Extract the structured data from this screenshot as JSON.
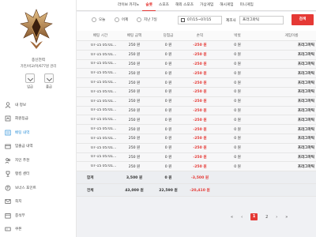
{
  "sidebar": {
    "profile_title": "종신전력",
    "profile_sub": "가민/비교/아/677원 관리",
    "quick": [
      {
        "label": "입금"
      },
      {
        "label": "출금"
      }
    ],
    "items": [
      {
        "label": "내 정보",
        "icon": "user-icon",
        "active": false
      },
      {
        "label": "회원등급",
        "icon": "grade-icon",
        "active": false
      },
      {
        "label": "배팅 내역",
        "icon": "list-icon",
        "active": true
      },
      {
        "label": "입출금 내역",
        "icon": "wallet-icon",
        "active": false
      },
      {
        "label": "지인 추천",
        "icon": "friends-icon",
        "active": false
      },
      {
        "label": "랭킹 센터",
        "icon": "trophy-icon",
        "active": false
      },
      {
        "label": "보너스 포인트",
        "icon": "coin-icon",
        "active": false
      },
      {
        "label": "쪽지",
        "icon": "message-icon",
        "active": false
      },
      {
        "label": "충석부",
        "icon": "calendar-icon",
        "active": false
      },
      {
        "label": "쿠폰",
        "icon": "coupon-icon",
        "active": false
      }
    ]
  },
  "tabs": [
    {
      "label": "라이브 카지노",
      "active": false
    },
    {
      "label": "슬롯",
      "active": true
    },
    {
      "label": "스포츠",
      "active": false
    },
    {
      "label": "해외 스포츠",
      "active": false
    },
    {
      "label": "가상게임",
      "active": false
    },
    {
      "label": "해시게임",
      "active": false
    },
    {
      "label": "미니게임",
      "active": false
    }
  ],
  "filter": {
    "today": "오늘",
    "yesterday": "어제",
    "last7": "지난 7일",
    "date_range": "07/15~07/15",
    "maker_label": "제조사",
    "maker_value": "프라그마틱",
    "search_label": "검색"
  },
  "table": {
    "headers": [
      "배팅 시간",
      "배팅 금액",
      "당첨금",
      "손익",
      "벅벗",
      "게임이름"
    ],
    "rows": [
      [
        "07-15 05:01...",
        "250 원",
        "0 원",
        "-250 원",
        "0 원",
        "프라그마틱"
      ],
      [
        "07-15 05:01...",
        "250 원",
        "0 원",
        "-250 원",
        "0 원",
        "프라그마틱"
      ],
      [
        "07-15 05:01...",
        "250 원",
        "0 원",
        "-250 원",
        "0 원",
        "프라그마틱"
      ],
      [
        "07-15 05:01...",
        "250 원",
        "0 원",
        "-250 원",
        "0 원",
        "프라그마틱"
      ],
      [
        "07-15 05:01...",
        "250 원",
        "0 원",
        "-250 원",
        "0 원",
        "프라그마틱"
      ],
      [
        "07-15 05:01...",
        "250 원",
        "0 원",
        "-250 원",
        "0 원",
        "프라그마틱"
      ],
      [
        "07-15 05:01...",
        "250 원",
        "0 원",
        "-250 원",
        "0 원",
        "프라그마틱"
      ],
      [
        "07-15 05:01...",
        "250 원",
        "0 원",
        "-250 원",
        "0 원",
        "프라그마틱"
      ],
      [
        "07-15 05:01...",
        "250 원",
        "0 원",
        "-250 원",
        "0 원",
        "프라그마틱"
      ],
      [
        "07-15 05:01...",
        "250 원",
        "0 원",
        "-250 원",
        "0 원",
        "프라그마틱"
      ],
      [
        "07-15 05:01...",
        "250 원",
        "0 원",
        "-250 원",
        "0 원",
        "프라그마틱"
      ],
      [
        "07-15 05:01...",
        "250 원",
        "0 원",
        "-250 원",
        "0 원",
        "프라그마틱"
      ],
      [
        "07-15 05:01...",
        "250 원",
        "0 원",
        "-250 원",
        "0 원",
        "프라그마틱"
      ],
      [
        "07-15 05:01...",
        "250 원",
        "0 원",
        "-250 원",
        "0 원",
        "프라그마틱"
      ]
    ],
    "subtotal": {
      "label": "합계",
      "bet": "3,500 원",
      "win": "0 원",
      "pl": "-3,500 원"
    },
    "total": {
      "label": "전체",
      "bet": "43,000 원",
      "win": "22,590 원",
      "pl": "-20,410 원"
    }
  },
  "pager": {
    "first": "«",
    "prev": "‹",
    "page1": "1",
    "page2": "2",
    "next": "›",
    "last": "»"
  },
  "colors": {
    "accent": "#e53935",
    "active_nav": "#2a8fd8"
  }
}
